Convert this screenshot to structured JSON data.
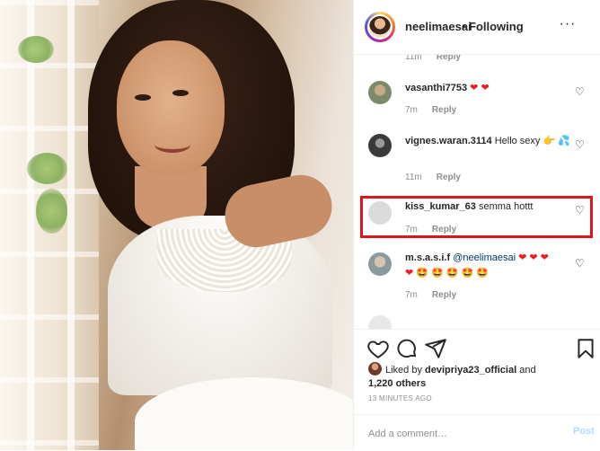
{
  "post_image": {
    "alt_icon": "photo-image"
  },
  "header": {
    "username": "neelimaesai",
    "separator": "•",
    "follow_status": "Following",
    "more_icon": "more-horizontal-icon",
    "more_label": "···"
  },
  "comments": [
    {
      "time": "11m",
      "reply": "Reply"
    },
    {
      "user": "vasanthi7753",
      "text": "",
      "emoji": "❤ ❤",
      "time": "7m",
      "reply": "Reply",
      "avatar_color": "#7b8a6a"
    },
    {
      "user": "vignes.waran.3114",
      "text": "Hello sexy",
      "emoji": "👉 💦",
      "time": "11m",
      "reply": "Reply",
      "avatar_color": "#3a3a3a"
    },
    {
      "user": "kiss_kumar_63",
      "text": "semma hottt",
      "emoji": "",
      "time": "7m",
      "reply": "Reply",
      "avatar_color": "#dbdbdb"
    },
    {
      "user": "m.s.a.s.i.f",
      "mention": "@neelimaesai",
      "emoji_line1": "❤ ❤ ❤",
      "emoji_line2": "❤ 🤩 🤩 🤩 🤩 🤩",
      "time": "7m",
      "reply": "Reply",
      "avatar_color": "#8a9aa0"
    }
  ],
  "actions": {
    "like_icon": "heart-icon",
    "comment_icon": "comment-bubble-icon",
    "share_icon": "paper-plane-icon",
    "save_icon": "bookmark-icon"
  },
  "likes": {
    "prefix": "Liked by",
    "user": "devipriya23_official",
    "and": "and",
    "others": "1,220 others"
  },
  "timestamp": "13 MINUTES AGO",
  "add_comment": {
    "placeholder": "Add a comment…",
    "post_label": "Post"
  },
  "colors": {
    "highlight": "#e0141e",
    "heart": "#ed1c24",
    "muted": "#8e8e8e",
    "post_disabled": "#b3dbff"
  }
}
